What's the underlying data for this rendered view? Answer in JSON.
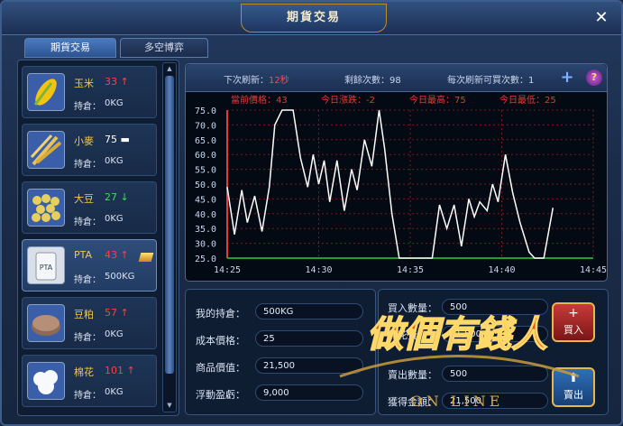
{
  "window": {
    "title": "期貨交易",
    "close_label": "✕"
  },
  "tabs": [
    {
      "label": "期貨交易",
      "active": true
    },
    {
      "label": "多空博弈",
      "active": false
    }
  ],
  "commodities": [
    {
      "name": "玉米",
      "price": "33",
      "trend": "up",
      "hold_label": "持倉：",
      "hold": "0KG",
      "icon": "corn-icon"
    },
    {
      "name": "小麥",
      "price": "75",
      "trend": "flat",
      "hold_label": "持倉：",
      "hold": "0KG",
      "icon": "wheat-icon"
    },
    {
      "name": "大豆",
      "price": "27",
      "trend": "down",
      "hold_label": "持倉：",
      "hold": "0KG",
      "icon": "soybean-icon"
    },
    {
      "name": "PTA",
      "price": "43",
      "trend": "up",
      "hold_label": "持倉：",
      "hold": "500KG",
      "icon": "pta-bag-icon",
      "selected": true
    },
    {
      "name": "豆粕",
      "price": "57",
      "trend": "up",
      "hold_label": "持倉：",
      "hold": "0KG",
      "icon": "soymeal-icon"
    },
    {
      "name": "棉花",
      "price": "101",
      "trend": "up",
      "hold_label": "持倉：",
      "hold": "0KG",
      "icon": "cotton-icon"
    }
  ],
  "chart_header": {
    "refresh_label": "下次刷新：",
    "refresh_value": "12秒",
    "remaining_label": "剩餘次數：",
    "remaining_value": "98",
    "buy_times_label": "每次刷新可買次數：",
    "buy_times_value": "1"
  },
  "chart_data": {
    "type": "line",
    "stats": {
      "current_label": "當前價格：43",
      "change_label": "今日漲跌：-2",
      "high_label": "今日最高：75",
      "low_label": "今日最低：25"
    },
    "x_ticks": [
      "14:25",
      "14:30",
      "14:35",
      "14:40",
      "14:45"
    ],
    "y_ticks": [
      "75.0",
      "70.0",
      "65.0",
      "60.0",
      "55.0",
      "50.0",
      "45.0",
      "40.0",
      "35.0",
      "30.0",
      "25.0"
    ],
    "ylim": [
      25,
      75
    ],
    "xlim": [
      0,
      20
    ],
    "points": [
      [
        0,
        49
      ],
      [
        0.4,
        33
      ],
      [
        0.8,
        48
      ],
      [
        1.1,
        37
      ],
      [
        1.5,
        46
      ],
      [
        1.9,
        34
      ],
      [
        2.3,
        49
      ],
      [
        2.6,
        70
      ],
      [
        3.0,
        75
      ],
      [
        3.6,
        75
      ],
      [
        4.0,
        59
      ],
      [
        4.4,
        49
      ],
      [
        4.7,
        60
      ],
      [
        5.0,
        50
      ],
      [
        5.3,
        58
      ],
      [
        5.6,
        44
      ],
      [
        6.0,
        58
      ],
      [
        6.4,
        41
      ],
      [
        6.8,
        55
      ],
      [
        7.1,
        48
      ],
      [
        7.5,
        65
      ],
      [
        7.9,
        56
      ],
      [
        8.3,
        75
      ],
      [
        8.6,
        62
      ],
      [
        9.0,
        40
      ],
      [
        9.4,
        25
      ],
      [
        11.2,
        25
      ],
      [
        11.6,
        43
      ],
      [
        12.0,
        35
      ],
      [
        12.4,
        43
      ],
      [
        12.8,
        29
      ],
      [
        13.2,
        45
      ],
      [
        13.5,
        39
      ],
      [
        13.8,
        44
      ],
      [
        14.2,
        41
      ],
      [
        14.5,
        50
      ],
      [
        14.8,
        44
      ],
      [
        15.2,
        60
      ],
      [
        15.6,
        47
      ],
      [
        16.0,
        37
      ],
      [
        16.5,
        27
      ],
      [
        16.8,
        25
      ],
      [
        17.3,
        25
      ],
      [
        17.8,
        42
      ]
    ],
    "line_color": "#ffffff",
    "baseline_color": "#2ecc40",
    "grid_color": "#7a1a1a"
  },
  "holdings": {
    "my_hold_label": "我的持倉：",
    "my_hold": "500KG",
    "cost_label": "成本價格：",
    "cost": "25",
    "value_label": "商品價值：",
    "value": "21,500",
    "pnl_label": "浮動盈虧：",
    "pnl": "9,000"
  },
  "trade": {
    "buy_qty_label": "買入數量：",
    "buy_qty": "500",
    "cost_label": "需花費：",
    "cost": "21,500",
    "sell_qty_label": "賣出數量：",
    "sell_qty": "500",
    "gain_label": "獲得金額：",
    "gain": "21,500",
    "buy_button": "買入",
    "sell_button": "賣出"
  },
  "watermark": {
    "text": "做個有錢人",
    "sub": "ON LINE"
  }
}
